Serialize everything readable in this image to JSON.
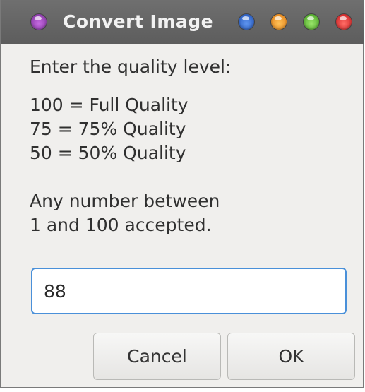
{
  "window": {
    "title": "Convert Image",
    "accent_color": "#4a90d9",
    "title_bar_buttons": [
      {
        "name": "menu-orb",
        "color": "#9b45c0"
      },
      {
        "name": "blue-orb",
        "color": "#3a73d6"
      },
      {
        "name": "orange-orb",
        "color": "#f5a030"
      },
      {
        "name": "green-orb",
        "color": "#6cc440"
      },
      {
        "name": "red-orb",
        "color": "#e6332f"
      }
    ]
  },
  "dialog": {
    "prompt": "Enter the quality level:",
    "options": [
      "100 = Full Quality",
      "75 = 75% Quality",
      "50 = 50% Quality"
    ],
    "note_line_1": "Any number between",
    "note_line_2": "1 and 100 accepted.",
    "input_value": "88"
  },
  "buttons": {
    "cancel_label": "Cancel",
    "ok_label": "OK"
  }
}
